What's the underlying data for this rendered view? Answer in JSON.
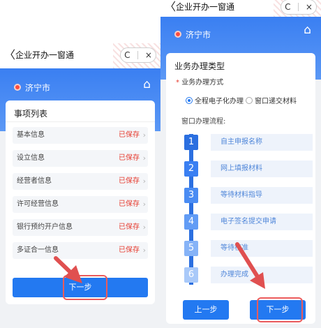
{
  "left": {
    "titlebar": {
      "back": "〈",
      "title": "企业开办一窗通"
    },
    "capsule": {
      "refresh": "C",
      "close": "×"
    },
    "header": {
      "city": "济宁市"
    },
    "card": {
      "title": "事项列表",
      "items": [
        {
          "label": "基本信息",
          "status": "已保存",
          "chevron": "›"
        },
        {
          "label": "设立信息",
          "status": "已保存",
          "chevron": "›"
        },
        {
          "label": "经营者信息",
          "status": "已保存",
          "chevron": "›"
        },
        {
          "label": "许可经营信息",
          "status": "已保存",
          "chevron": "›"
        },
        {
          "label": "银行预约开户信息",
          "status": "已保存",
          "chevron": "›"
        },
        {
          "label": "多证合一信息",
          "status": "已保存",
          "chevron": "›"
        }
      ],
      "next_button": "下一步"
    }
  },
  "right": {
    "titlebar": {
      "back": "〈",
      "title": "企业开办一窗通"
    },
    "capsule": {
      "refresh": "C",
      "close": "×"
    },
    "header": {
      "city": "济宁市"
    },
    "card": {
      "title": "业务办理类型",
      "required_mark": "*",
      "method_label": "业务办理方式",
      "options": [
        {
          "label": "全程电子化办理",
          "selected": true
        },
        {
          "label": "窗口递交材料",
          "selected": false
        }
      ],
      "flow_label": "窗口办理流程:",
      "steps": [
        {
          "num": "1",
          "label": "自主申报名称"
        },
        {
          "num": "2",
          "label": "网上填报材料"
        },
        {
          "num": "3",
          "label": "等待材料指导"
        },
        {
          "num": "4",
          "label": "电子签名提交申请"
        },
        {
          "num": "5",
          "label": "等待核准"
        },
        {
          "num": "6",
          "label": "办理完成"
        }
      ],
      "prev_button": "上一步",
      "next_button": "下一步"
    }
  },
  "colors": {
    "primary": "#2379f1",
    "header_blue": "#3a7ff2",
    "saved_red": "#e63a2e",
    "highlight_red": "#ec5b5b",
    "arrow_red": "#e05050"
  }
}
